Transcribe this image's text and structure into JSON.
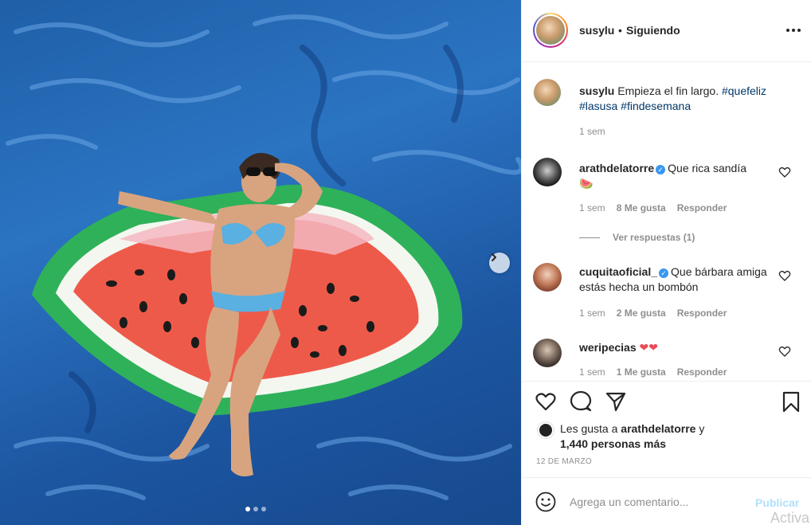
{
  "post": {
    "username": "susylu",
    "separator": "•",
    "follow_status": "Siguiendo",
    "more_icon": "more-horizontal-icon"
  },
  "caption": {
    "username": "susylu",
    "text": "Empieza el fin largo.",
    "hashtags": [
      "#quefeliz",
      "#lasusa",
      "#findesemana"
    ],
    "time": "1 sem"
  },
  "comments": [
    {
      "username": "arathdelatorre",
      "verified": true,
      "text": "Que rica sandía",
      "emoji": "🍉",
      "time": "1 sem",
      "likes": "8 Me gusta",
      "reply": "Responder",
      "view_replies": "Ver respuestas (1)"
    },
    {
      "username": "cuquitaoficial_",
      "verified": true,
      "text": "Que bárbara amiga estás hecha un bombón",
      "time": "1 sem",
      "likes": "2 Me gusta",
      "reply": "Responder"
    },
    {
      "username": "weripecias",
      "verified": false,
      "text": "",
      "emoji": "❤❤",
      "time": "1 sem",
      "likes": "1 Me gusta",
      "reply": "Responder"
    }
  ],
  "likes": {
    "prefix": "Les gusta a",
    "user": "arathdelatorre",
    "joiner": "y",
    "others": "1,440 personas más"
  },
  "date": "12 DE MARZO",
  "add_comment": {
    "placeholder": "Agrega un comentario...",
    "publish": "Publicar"
  },
  "watermark": "Activa",
  "carousel": {
    "total": 3,
    "active": 1
  },
  "colors": {
    "link": "#00376b",
    "muted": "#8e8e8e",
    "verified": "#3897f0",
    "publish_disabled": "#b2dffc",
    "heart": "#ed4956"
  }
}
